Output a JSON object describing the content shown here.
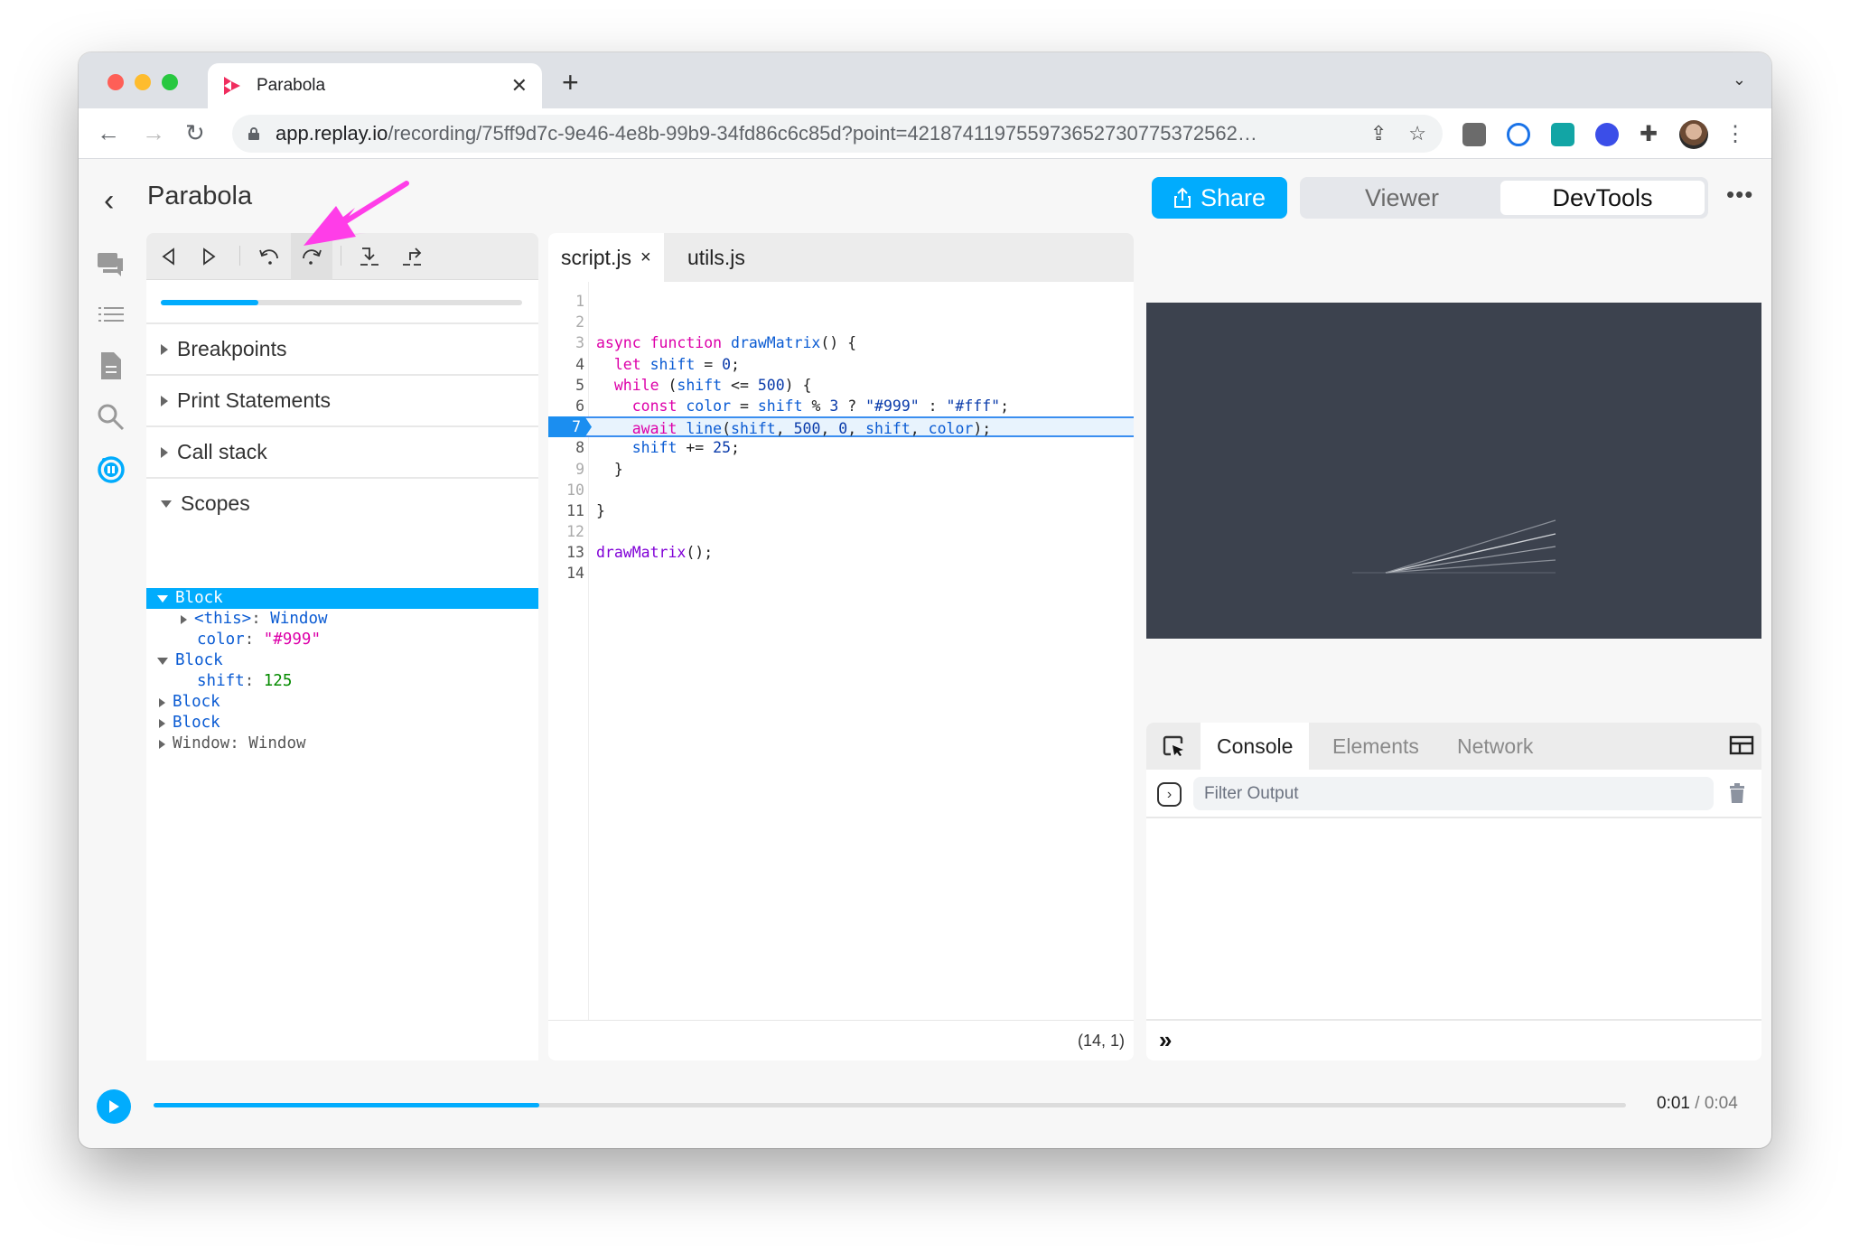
{
  "browser": {
    "tab_title": "Parabola",
    "new_tab_label": "+",
    "url_host": "app.replay.io",
    "url_path": "/recording/75ff9d7c-9e46-4e8b-99b9-34fd86c6c85d?point=421874119755973652730775372562…",
    "extensions": [
      "ext-gray-icon",
      "ext-lock-icon",
      "ext-teal-icon",
      "ext-blue-icon",
      "puzzle-icon"
    ]
  },
  "header": {
    "title": "Parabola",
    "share_label": "Share",
    "modes": [
      "Viewer",
      "DevTools"
    ],
    "active_mode": "DevTools",
    "more_label": "•••"
  },
  "sidebar": {
    "icons": [
      "comments-icon",
      "events-list-icon",
      "source-file-icon",
      "search-icon",
      "debugger-pause-icon"
    ],
    "active": "debugger-pause-icon"
  },
  "debugger": {
    "toolbar": [
      "rewind-icon",
      "resume-icon",
      "reverse-step-over-icon",
      "step-over-icon",
      "step-in-icon",
      "step-out-icon"
    ],
    "highlighted_button": "step-over-icon",
    "progress": 0.27,
    "sections": {
      "breakpoints": "Breakpoints",
      "print_statements": "Print Statements",
      "call_stack": "Call stack",
      "scopes": "Scopes"
    },
    "scopes": {
      "block1": "Block",
      "this_key": "<this>",
      "this_val": "Window",
      "color_key": "color",
      "color_val": "\"#999\"",
      "block2": "Block",
      "shift_key": "shift",
      "shift_val": "125",
      "block3": "Block",
      "block4": "Block",
      "window_key": "Window",
      "window_val": "Window"
    }
  },
  "editor": {
    "tabs": [
      {
        "label": "script.js",
        "close": "×"
      },
      {
        "label": "utils.js"
      }
    ],
    "paused_line": 7,
    "lines": [
      "1",
      "2",
      "3",
      "4",
      "5",
      "6",
      "7",
      "8",
      "9",
      "10",
      "11",
      "12",
      "13",
      "14"
    ],
    "code": {
      "l3_async": "async",
      "l3_function": "function",
      "l3_name": "drawMatrix",
      "l3_rest": "() {",
      "l4_let": "let",
      "l4_var": "shift",
      "l4_eq": " = ",
      "l4_num": "0",
      "l4_end": ";",
      "l5_while": "while",
      "l5_open": " (",
      "l5_var": "shift",
      "l5_op": " <= ",
      "l5_num": "500",
      "l5_end": ") {",
      "l6_const": "const",
      "l6_var": "color",
      "l6_eq": " = ",
      "l6_shift": "shift",
      "l6_mod": " % ",
      "l6_three": "3",
      "l6_q": " ? ",
      "l6_s1": "\"#999\"",
      "l6_c": " : ",
      "l6_s2": "\"#fff\"",
      "l6_end": ";",
      "l7_await": "await",
      "l7_fn": "line",
      "l7_open": "(",
      "l7_a1": "shift",
      "l7_c1": ", ",
      "l7_a2": "500",
      "l7_c2": ", ",
      "l7_a3": "0",
      "l7_c3": ", ",
      "l7_a4": "shift",
      "l7_c4": ", ",
      "l7_a5": "color",
      "l7_end": ");",
      "l8_var": "shift",
      "l8_op": " += ",
      "l8_num": "25",
      "l8_end": ";",
      "l9": "}",
      "l11": "}",
      "l13_call": "drawMatrix",
      "l13_end": "();"
    },
    "cursor_position": "(14, 1)"
  },
  "console": {
    "tabs": [
      "Console",
      "Elements",
      "Network"
    ],
    "active_tab": "Console",
    "filter_placeholder": "Filter Output",
    "filter_value": "",
    "prompt": "»"
  },
  "timeline": {
    "current": "0:01",
    "separator": " / ",
    "total": "0:04",
    "progress": 0.262
  },
  "colors": {
    "accent": "#01acfd",
    "canvas_bg": "#3c424e",
    "annotation_arrow": "#ff3de8"
  }
}
